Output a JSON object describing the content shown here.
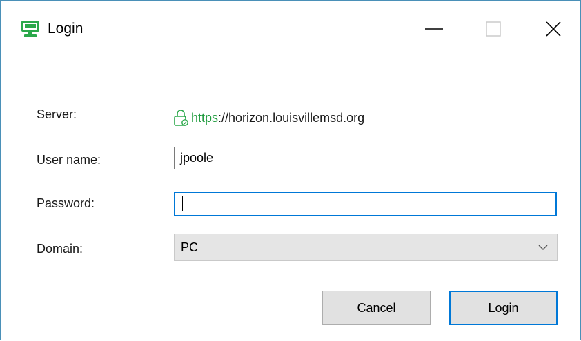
{
  "window": {
    "title": "Login",
    "controls": {
      "minimize_icon": "minimize-icon",
      "maximize_icon": "maximize-icon",
      "close_icon": "close-icon"
    }
  },
  "form": {
    "server": {
      "label": "Server:",
      "scheme": "https",
      "rest": "://horizon.louisvillemsd.org",
      "icon": "secure-lock-icon"
    },
    "username": {
      "label": "User name:",
      "value": "jpoole"
    },
    "password": {
      "label": "Password:",
      "value": ""
    },
    "domain": {
      "label": "Domain:",
      "selected": "PC"
    }
  },
  "buttons": {
    "cancel": "Cancel",
    "login": "Login"
  },
  "colors": {
    "accent": "#0078d7",
    "brand_green": "#1d9a3c",
    "window_border": "#4a90b8"
  }
}
